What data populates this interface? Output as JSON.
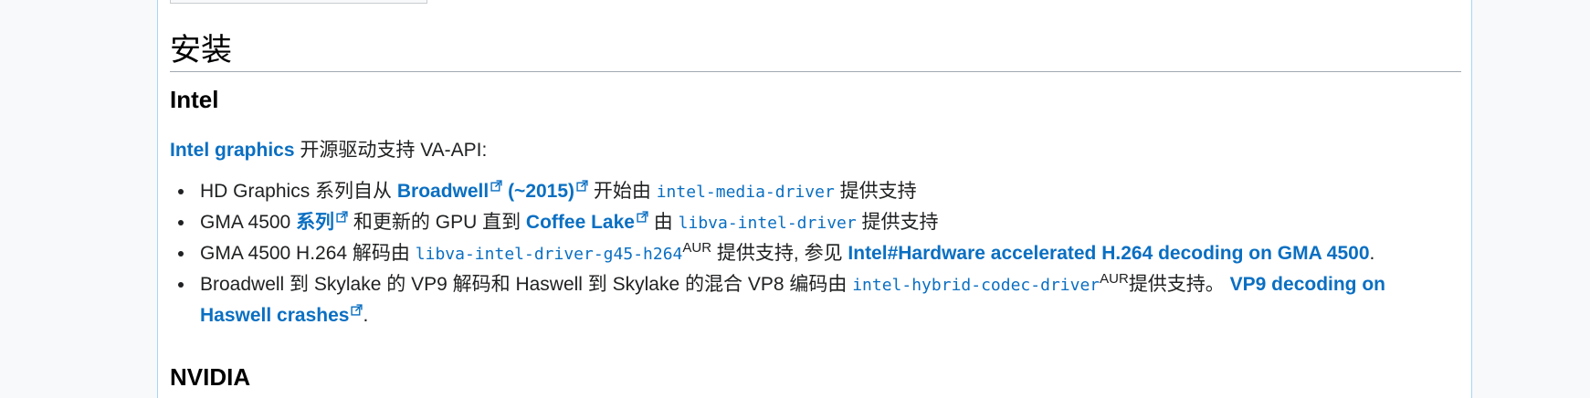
{
  "section": {
    "title": "安装"
  },
  "intel": {
    "heading": "Intel",
    "intro_link": "Intel graphics",
    "intro_text": " 开源驱动支持 VA-API:",
    "items": [
      {
        "t1": "HD Graphics 系列自从 ",
        "link1": "Broadwell",
        "link2": " (~2015)",
        "t2": " 开始由 ",
        "code": "intel-media-driver",
        "t3": " 提供支持"
      },
      {
        "t1": "GMA 4500 ",
        "link1": "系列",
        "t2": " 和更新的 GPU 直到 ",
        "link2": "Coffee Lake",
        "t3": " 由 ",
        "code": "libva-intel-driver",
        "t4": " 提供支持"
      },
      {
        "t1": "GMA 4500 H.264 解码由 ",
        "code": "libva-intel-driver-g45-h264",
        "sup": "AUR",
        "t2": " 提供支持, 参见 ",
        "link1": "Intel#Hardware accelerated H.264 decoding on GMA 4500",
        "t3": "."
      },
      {
        "t1": "Broadwell 到 Skylake 的 VP9 解码和 Haswell 到 Skylake 的混合 VP8 编码由 ",
        "code": "intel-hybrid-codec-driver",
        "sup": "AUR",
        "t2": "提供支持。 ",
        "link1": "VP9 decoding on Haswell crashes",
        "t3": "."
      }
    ]
  },
  "nvidia": {
    "heading": "NVIDIA"
  },
  "icons": {
    "external_link": "external-link-icon"
  },
  "colors": {
    "link": "#0a6fc2",
    "text": "#202122",
    "border": "#a2a9b1"
  }
}
